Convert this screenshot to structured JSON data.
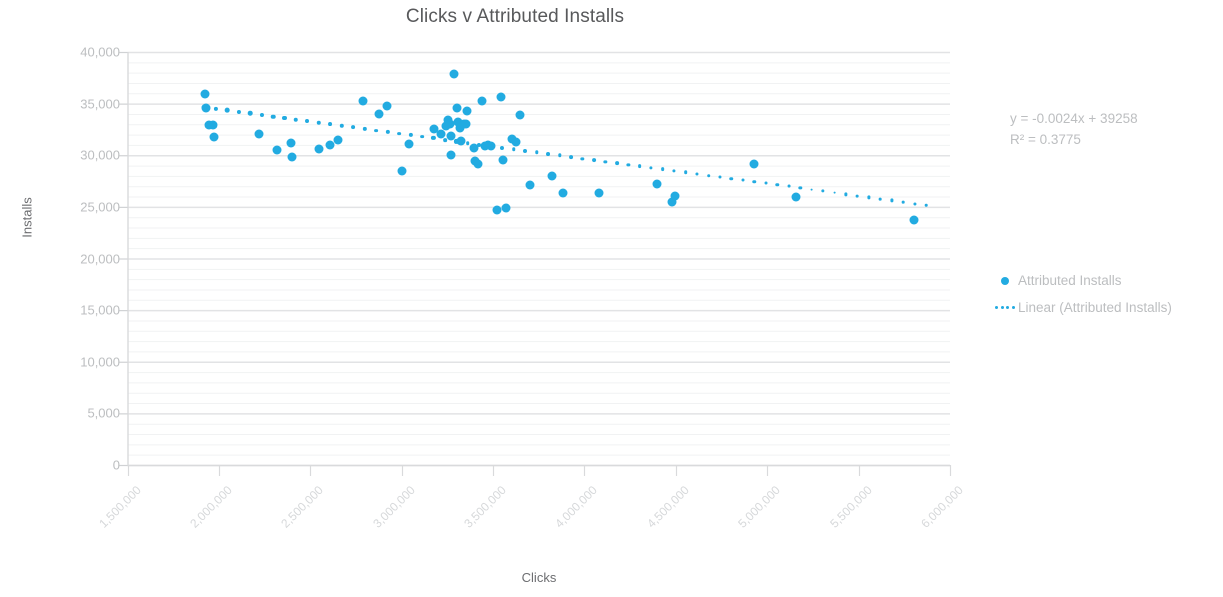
{
  "chart_data": {
    "type": "scatter",
    "title": "Clicks v Attributed Installs",
    "xlabel": "Clicks",
    "ylabel": "Installs",
    "xlim": [
      1500000,
      6000000
    ],
    "ylim": [
      0,
      40000
    ],
    "x_ticks": [
      "1,500,000",
      "2,000,000",
      "2,500,000",
      "3,000,000",
      "3,500,000",
      "4,000,000",
      "4,500,000",
      "5,000,000",
      "5,500,000",
      "6,000,000"
    ],
    "x_tick_values": [
      1500000,
      2000000,
      2500000,
      3000000,
      3500000,
      4000000,
      4500000,
      5000000,
      5500000,
      6000000
    ],
    "y_ticks": [
      "0",
      "5,000",
      "10,000",
      "15,000",
      "20,000",
      "25,000",
      "30,000",
      "35,000",
      "40,000"
    ],
    "y_tick_values": [
      0,
      5000,
      10000,
      15000,
      20000,
      25000,
      30000,
      35000,
      40000
    ],
    "grid": true,
    "minor_grid_step": 1000,
    "legend_position": "right",
    "marker_color": "#22ABE1",
    "trendline_color": "#22ABE1",
    "series": [
      {
        "name": "Attributed Installs",
        "points": [
          [
            1925000,
            35900
          ],
          [
            1930000,
            34600
          ],
          [
            1945000,
            32900
          ],
          [
            1968000,
            32900
          ],
          [
            1975000,
            31800
          ],
          [
            2218000,
            32100
          ],
          [
            2320000,
            30500
          ],
          [
            2395000,
            31200
          ],
          [
            2400000,
            29800
          ],
          [
            2545000,
            30600
          ],
          [
            2610000,
            31000
          ],
          [
            2650000,
            31500
          ],
          [
            2790000,
            35300
          ],
          [
            2875000,
            34000
          ],
          [
            2920000,
            34800
          ],
          [
            3000000,
            28500
          ],
          [
            3040000,
            31100
          ],
          [
            3175000,
            32500
          ],
          [
            3215000,
            32100
          ],
          [
            3240000,
            32800
          ],
          [
            3255000,
            33400
          ],
          [
            3262000,
            33000
          ],
          [
            3268000,
            31900
          ],
          [
            3272000,
            30000
          ],
          [
            3285000,
            37900
          ],
          [
            3300000,
            34600
          ],
          [
            3310000,
            33200
          ],
          [
            3318000,
            32600
          ],
          [
            3325000,
            31400
          ],
          [
            3340000,
            33000
          ],
          [
            3352000,
            33000
          ],
          [
            3360000,
            34300
          ],
          [
            3395000,
            30700
          ],
          [
            3400000,
            29400
          ],
          [
            3415000,
            29200
          ],
          [
            3440000,
            35300
          ],
          [
            3455000,
            30900
          ],
          [
            3470000,
            31000
          ],
          [
            3490000,
            30900
          ],
          [
            3520000,
            24700
          ],
          [
            3545000,
            35600
          ],
          [
            3555000,
            29500
          ],
          [
            3570000,
            24900
          ],
          [
            3605000,
            31600
          ],
          [
            3625000,
            31300
          ],
          [
            3650000,
            33900
          ],
          [
            3700000,
            27100
          ],
          [
            3825000,
            28000
          ],
          [
            3885000,
            26300
          ],
          [
            4080000,
            26300
          ],
          [
            4395000,
            27200
          ],
          [
            4480000,
            25500
          ],
          [
            4495000,
            26100
          ],
          [
            4930000,
            29200
          ],
          [
            5160000,
            26000
          ],
          [
            5805000,
            23700
          ]
        ]
      }
    ],
    "trendline": {
      "name": "Linear (Attributed Installs)",
      "equation": "y = -0.0024x + 39258",
      "r_squared": "R² = 0.3775",
      "slope": -0.0024,
      "intercept": 39258,
      "x_start": 1920000,
      "x_end": 5870000
    }
  },
  "legend": {
    "items": [
      {
        "label": "Attributed Installs",
        "key": "scatter-dot-key"
      },
      {
        "label": "Linear (Attributed Installs)",
        "key": "dotted-line-key"
      }
    ]
  }
}
